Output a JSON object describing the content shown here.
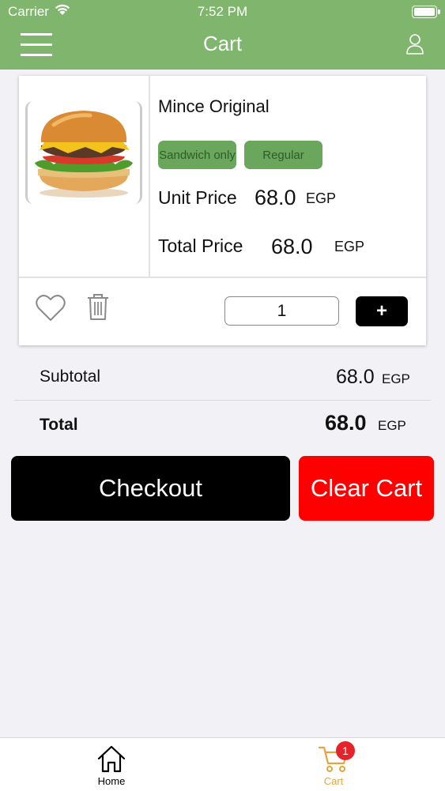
{
  "status_bar": {
    "carrier": "Carrier",
    "time": "7:52 PM"
  },
  "header": {
    "title": "Cart"
  },
  "cart_item": {
    "name": "Mince Original",
    "options": [
      "Sandwich only",
      "Regular"
    ],
    "unit_price_label": "Unit Price",
    "unit_price": "68.0",
    "unit_currency": "EGP",
    "total_price_label": "Total Price",
    "total_price": "68.0",
    "total_currency": "EGP",
    "quantity": "1",
    "plus_label": "+"
  },
  "summary": {
    "subtotal_label": "Subtotal",
    "subtotal_value": "68.0",
    "subtotal_currency": "EGP",
    "total_label": "Total",
    "total_value": "68.0",
    "total_currency": "EGP"
  },
  "actions": {
    "checkout": "Checkout",
    "clear_cart": "Clear Cart"
  },
  "tabbar": {
    "home": "Home",
    "cart": "Cart",
    "cart_badge": "1"
  },
  "colors": {
    "header": "#7fb56c",
    "chip": "#6aa75c",
    "clear_cart": "#fe0000",
    "checkout": "#000000",
    "cart_tab_active": "#e8a33c",
    "badge": "#e5232a"
  }
}
